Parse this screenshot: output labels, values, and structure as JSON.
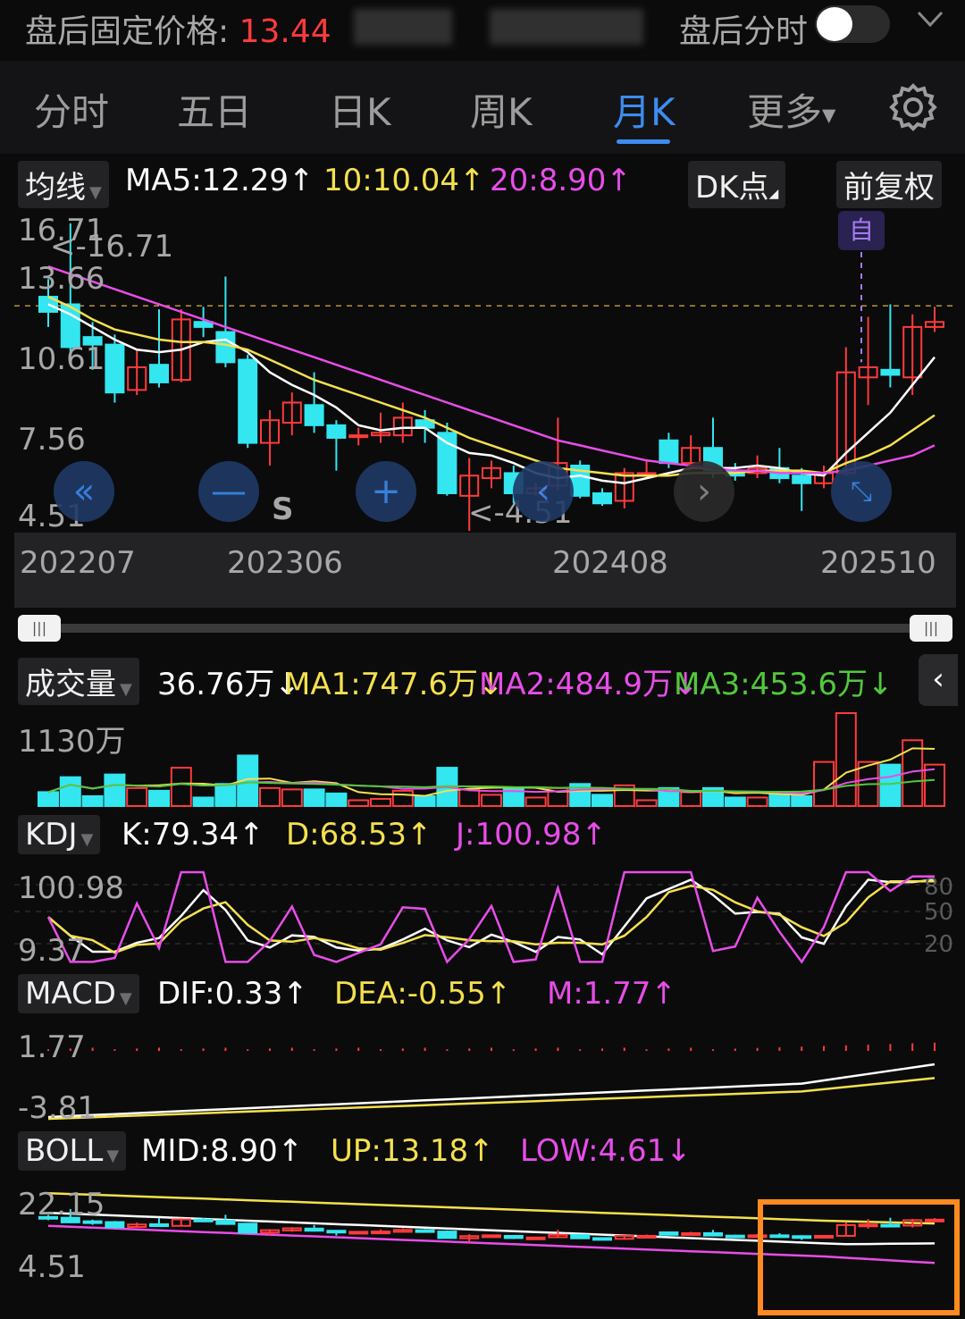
{
  "top": {
    "price_label": "盘后固定价格:",
    "price_value": "13.44",
    "after_hours_label": "盘后分时",
    "after_hours_on": false
  },
  "tabs": [
    {
      "label": "分时",
      "active": false
    },
    {
      "label": "五日",
      "active": false
    },
    {
      "label": "日K",
      "active": false
    },
    {
      "label": "周K",
      "active": false
    },
    {
      "label": "月K",
      "active": true
    },
    {
      "label": "更多",
      "active": false
    }
  ],
  "ma_header": {
    "selector": "均线",
    "ma5": "MA5:12.29",
    "ma10": "10:10.04",
    "ma20": "20:8.90",
    "dk_button": "DK点",
    "adjust_button": "前复权"
  },
  "kline": {
    "y_ticks": [
      "16.71",
      "13.66",
      "10.61",
      "7.56",
      "4.51"
    ],
    "max_label": "<-16.71",
    "min_label": "<-4.51",
    "sell_marker": "S",
    "self_marker": "自",
    "x_ticks": [
      "202207",
      "202306",
      "202408",
      "202510"
    ],
    "controls": [
      "rewind-icon",
      "zoom-out-icon",
      "zoom-in-icon",
      "prev-icon",
      "next-icon",
      "expand-icon"
    ]
  },
  "volume": {
    "selector": "成交量",
    "value": "36.76万",
    "ma1": "MA1:747.6万",
    "ma2": "MA2:484.9万",
    "ma3": "MA3:453.6万",
    "y_top": "1130万"
  },
  "kdj": {
    "selector": "KDJ",
    "k": "K:79.34",
    "d": "D:68.53",
    "j": "J:100.98",
    "y_top": "100.98",
    "y_bottom": "9.37",
    "levels": [
      "80",
      "50",
      "20"
    ]
  },
  "macd": {
    "selector": "MACD",
    "dif": "DIF:0.33",
    "dea": "DEA:-0.55",
    "m": "M:1.77",
    "y_top": "1.77",
    "y_bottom": "-3.81"
  },
  "boll": {
    "selector": "BOLL",
    "mid": "MID:8.90",
    "up": "UP:13.18",
    "low": "LOW:4.61",
    "y_top": "22.15",
    "y_bottom": "4.51"
  },
  "colors": {
    "up": "#ff3b3b",
    "down": "#33e6f0",
    "ma5": "#ffffff",
    "ma10": "#f4e04d",
    "ma20": "#e84de8",
    "ma3": "#52c83c",
    "accent": "#3d8cf0",
    "highlight": "#ff8a1f"
  },
  "chart_data": {
    "type": "candlestick",
    "x_ticks": [
      "202207",
      "202306",
      "202408",
      "202510"
    ],
    "ylim": [
      4.51,
      16.71
    ],
    "candles": [
      {
        "o": 13.8,
        "c": 13.2,
        "h": 14.5,
        "l": 12.6
      },
      {
        "o": 13.5,
        "c": 11.8,
        "h": 16.71,
        "l": 11.5
      },
      {
        "o": 12.2,
        "c": 11.9,
        "h": 12.8,
        "l": 10.9
      },
      {
        "o": 11.9,
        "c": 10.0,
        "h": 12.3,
        "l": 9.6
      },
      {
        "o": 10.1,
        "c": 11.0,
        "h": 11.7,
        "l": 9.9
      },
      {
        "o": 11.1,
        "c": 10.4,
        "h": 13.3,
        "l": 10.2
      },
      {
        "o": 10.5,
        "c": 12.9,
        "h": 13.3,
        "l": 10.4
      },
      {
        "o": 12.8,
        "c": 12.6,
        "h": 13.4,
        "l": 12.2
      },
      {
        "o": 12.4,
        "c": 11.2,
        "h": 14.6,
        "l": 11.0
      },
      {
        "o": 11.3,
        "c": 8.0,
        "h": 11.5,
        "l": 7.8
      },
      {
        "o": 8.0,
        "c": 8.9,
        "h": 9.3,
        "l": 7.1
      },
      {
        "o": 8.8,
        "c": 9.6,
        "h": 10.0,
        "l": 8.3
      },
      {
        "o": 9.5,
        "c": 8.7,
        "h": 10.8,
        "l": 8.4
      },
      {
        "o": 8.7,
        "c": 8.2,
        "h": 8.9,
        "l": 6.9
      },
      {
        "o": 8.3,
        "c": 8.3,
        "h": 8.6,
        "l": 7.9
      },
      {
        "o": 8.3,
        "c": 8.4,
        "h": 9.2,
        "l": 8.0
      },
      {
        "o": 8.3,
        "c": 9.0,
        "h": 9.6,
        "l": 8.0
      },
      {
        "o": 8.9,
        "c": 8.6,
        "h": 9.3,
        "l": 8.0
      },
      {
        "o": 8.4,
        "c": 6.0,
        "h": 8.8,
        "l": 5.9
      },
      {
        "o": 5.9,
        "c": 6.7,
        "h": 7.4,
        "l": 4.51
      },
      {
        "o": 6.6,
        "c": 7.0,
        "h": 7.3,
        "l": 6.2
      },
      {
        "o": 6.8,
        "c": 6.0,
        "h": 7.1,
        "l": 5.6
      },
      {
        "o": 6.0,
        "c": 6.2,
        "h": 6.4,
        "l": 5.9
      },
      {
        "o": 6.3,
        "c": 7.2,
        "h": 9.0,
        "l": 6.1
      },
      {
        "o": 7.1,
        "c": 5.9,
        "h": 7.3,
        "l": 5.8
      },
      {
        "o": 6.0,
        "c": 5.6,
        "h": 6.2,
        "l": 5.5
      },
      {
        "o": 5.7,
        "c": 6.8,
        "h": 7.0,
        "l": 5.4
      },
      {
        "o": 6.8,
        "c": 6.8,
        "h": 7.3,
        "l": 6.6
      },
      {
        "o": 8.1,
        "c": 7.2,
        "h": 8.4,
        "l": 7.0
      },
      {
        "o": 7.2,
        "c": 7.8,
        "h": 8.3,
        "l": 6.9
      },
      {
        "o": 7.8,
        "c": 6.9,
        "h": 9.0,
        "l": 6.6
      },
      {
        "o": 6.9,
        "c": 6.7,
        "h": 7.2,
        "l": 6.5
      },
      {
        "o": 6.8,
        "c": 7.0,
        "h": 7.5,
        "l": 6.6
      },
      {
        "o": 7.0,
        "c": 6.6,
        "h": 7.8,
        "l": 6.4
      },
      {
        "o": 6.7,
        "c": 6.4,
        "h": 7.0,
        "l": 5.3
      },
      {
        "o": 6.4,
        "c": 6.8,
        "h": 7.1,
        "l": 6.2
      },
      {
        "o": 6.8,
        "c": 10.8,
        "h": 11.8,
        "l": 6.7
      },
      {
        "o": 10.6,
        "c": 11.0,
        "h": 13.0,
        "l": 9.5
      },
      {
        "o": 10.9,
        "c": 10.7,
        "h": 13.5,
        "l": 10.2
      },
      {
        "o": 10.6,
        "c": 12.6,
        "h": 13.1,
        "l": 9.9
      },
      {
        "o": 12.6,
        "c": 12.8,
        "h": 13.4,
        "l": 12.4
      }
    ],
    "series": [
      {
        "name": "MA5",
        "values": [
          13.5,
          13.1,
          12.6,
          12.1,
          11.7,
          11.6,
          11.7,
          12.0,
          12.1,
          11.6,
          10.8,
          10.3,
          9.9,
          9.4,
          8.7,
          8.5,
          8.6,
          8.6,
          8.0,
          7.6,
          7.5,
          7.2,
          6.8,
          6.6,
          6.7,
          6.5,
          6.4,
          6.6,
          6.8,
          7.0,
          7.0,
          7.0,
          7.1,
          7.0,
          6.8,
          6.7,
          7.6,
          8.4,
          9.2,
          10.3,
          11.4
        ]
      },
      {
        "name": "10",
        "values": [
          13.8,
          13.4,
          12.9,
          12.5,
          12.3,
          12.1,
          12.0,
          12.0,
          11.9,
          11.7,
          11.3,
          10.9,
          10.5,
          10.2,
          9.9,
          9.6,
          9.3,
          9.0,
          8.6,
          8.2,
          7.9,
          7.6,
          7.3,
          7.0,
          6.9,
          6.8,
          6.7,
          6.7,
          6.7,
          6.8,
          6.8,
          6.8,
          6.9,
          6.9,
          6.9,
          6.8,
          7.2,
          7.5,
          7.9,
          8.5,
          9.1
        ]
      },
      {
        "name": "20",
        "values": [
          15.0,
          14.7,
          14.4,
          14.1,
          13.8,
          13.5,
          13.2,
          12.9,
          12.6,
          12.3,
          12.0,
          11.7,
          11.4,
          11.1,
          10.8,
          10.5,
          10.2,
          9.9,
          9.6,
          9.3,
          9.0,
          8.7,
          8.4,
          8.1,
          7.9,
          7.7,
          7.5,
          7.3,
          7.2,
          7.1,
          7.0,
          6.9,
          6.9,
          6.8,
          6.8,
          6.8,
          6.9,
          7.1,
          7.3,
          7.5,
          7.9
        ]
      }
    ]
  }
}
